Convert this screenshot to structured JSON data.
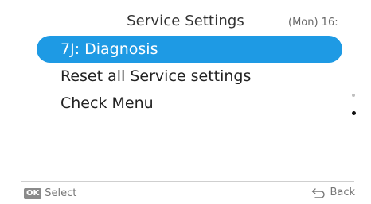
{
  "header": {
    "title": "Service Settings",
    "clock": "(Mon) 16:"
  },
  "menu": {
    "items": [
      {
        "label": "7J: Diagnosis",
        "selected": true
      },
      {
        "label": "Reset all Service settings",
        "selected": false
      },
      {
        "label": "Check Menu",
        "selected": false
      }
    ]
  },
  "scroll": {
    "pages": 2,
    "current_page": 2
  },
  "footer": {
    "ok_badge": "OK",
    "select_label": "Select",
    "back_label": "Back",
    "back_icon": "back-arrow-icon"
  },
  "colors": {
    "selection": "#1e9ae4",
    "background": "#ffffff"
  }
}
